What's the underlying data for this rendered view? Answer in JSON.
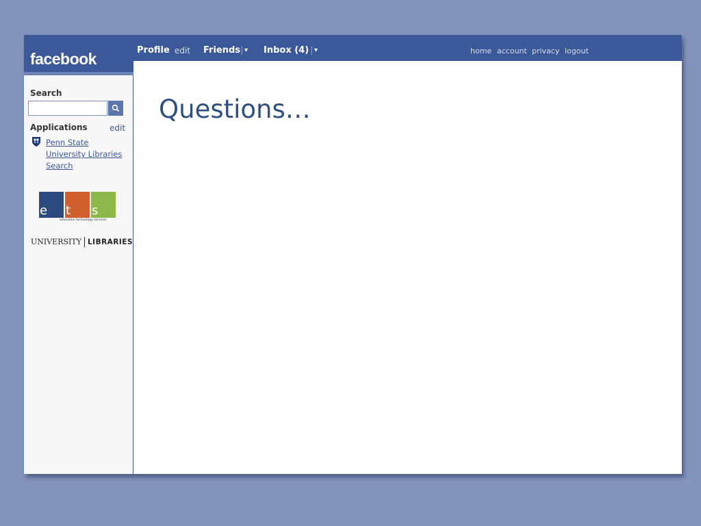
{
  "brand": {
    "logo_text": "facebook"
  },
  "nav": {
    "profile": "Profile",
    "profile_edit": "edit",
    "friends": "Friends",
    "inbox": "Inbox (4)",
    "dropdown_glyph": "▾",
    "right_links": [
      "home",
      "account",
      "privacy",
      "logout"
    ]
  },
  "sidebar": {
    "search_label": "Search",
    "search_value": "",
    "applications_label": "Applications",
    "applications_edit": "edit",
    "app_link": "Penn State University Libraries Search",
    "ets_letters": [
      "e",
      "t",
      "s"
    ],
    "ets_caption": "education technology services",
    "ets_colors": [
      "#2d4a7f",
      "#d2602e",
      "#8cb84a"
    ],
    "ul_logo_left": "UNIVERSITY",
    "ul_logo_right": "LIBRARIES"
  },
  "main": {
    "title": "Questions…"
  },
  "colors": {
    "brand_blue": "#3b5998",
    "title_blue": "#2f4f80",
    "page_bg": "#8394bd"
  }
}
